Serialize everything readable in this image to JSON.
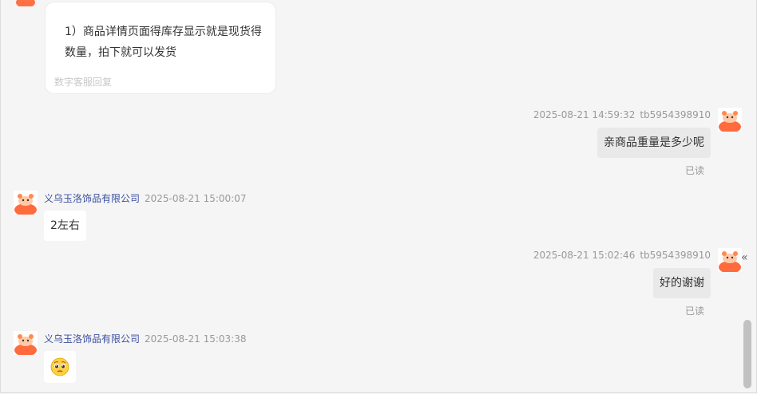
{
  "colors": {
    "shop_name": "#3b4fa0",
    "customer_bubble": "#e9e9e9",
    "agent_bubble": "#ffffff"
  },
  "top_card": {
    "text": "1）商品详情页面得库存显示就是现货得数量，拍下就可以发货",
    "footer": "数字客服回复"
  },
  "messages": [
    {
      "side": "right",
      "time": "2025-08-21 14:59:32",
      "user": "tb5954398910",
      "text": "亲商品重量是多少呢",
      "status": "已读"
    },
    {
      "side": "left",
      "shop": "义乌玉洛饰品有限公司",
      "time": "2025-08-21 15:00:07",
      "text": "2左右"
    },
    {
      "side": "right",
      "time": "2025-08-21 15:02:46",
      "user": "tb5954398910",
      "text": "好的谢谢",
      "status": "已读"
    },
    {
      "side": "left",
      "shop": "义乌玉洛饰品有限公司",
      "time": "2025-08-21 15:03:38",
      "emoji": "pleading-face-emoji"
    }
  ],
  "collapse_label": "«"
}
